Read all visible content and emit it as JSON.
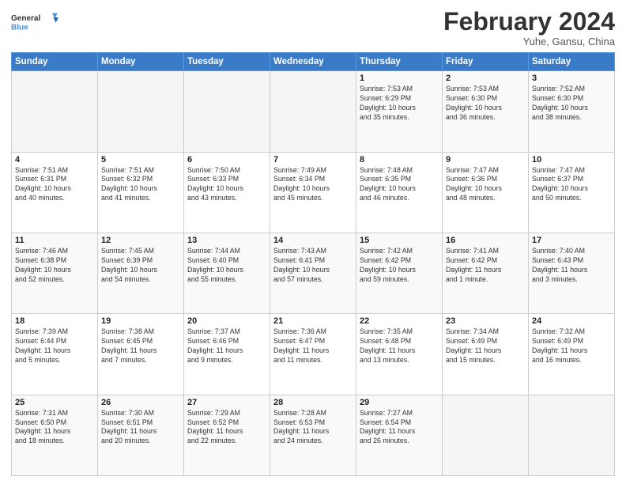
{
  "header": {
    "logo_general": "General",
    "logo_blue": "Blue",
    "month_title": "February 2024",
    "subtitle": "Yuhe, Gansu, China"
  },
  "days_of_week": [
    "Sunday",
    "Monday",
    "Tuesday",
    "Wednesday",
    "Thursday",
    "Friday",
    "Saturday"
  ],
  "weeks": [
    [
      {
        "day": "",
        "info": ""
      },
      {
        "day": "",
        "info": ""
      },
      {
        "day": "",
        "info": ""
      },
      {
        "day": "",
        "info": ""
      },
      {
        "day": "1",
        "info": "Sunrise: 7:53 AM\nSunset: 6:29 PM\nDaylight: 10 hours\nand 35 minutes."
      },
      {
        "day": "2",
        "info": "Sunrise: 7:53 AM\nSunset: 6:30 PM\nDaylight: 10 hours\nand 36 minutes."
      },
      {
        "day": "3",
        "info": "Sunrise: 7:52 AM\nSunset: 6:30 PM\nDaylight: 10 hours\nand 38 minutes."
      }
    ],
    [
      {
        "day": "4",
        "info": "Sunrise: 7:51 AM\nSunset: 6:31 PM\nDaylight: 10 hours\nand 40 minutes."
      },
      {
        "day": "5",
        "info": "Sunrise: 7:51 AM\nSunset: 6:32 PM\nDaylight: 10 hours\nand 41 minutes."
      },
      {
        "day": "6",
        "info": "Sunrise: 7:50 AM\nSunset: 6:33 PM\nDaylight: 10 hours\nand 43 minutes."
      },
      {
        "day": "7",
        "info": "Sunrise: 7:49 AM\nSunset: 6:34 PM\nDaylight: 10 hours\nand 45 minutes."
      },
      {
        "day": "8",
        "info": "Sunrise: 7:48 AM\nSunset: 6:35 PM\nDaylight: 10 hours\nand 46 minutes."
      },
      {
        "day": "9",
        "info": "Sunrise: 7:47 AM\nSunset: 6:36 PM\nDaylight: 10 hours\nand 48 minutes."
      },
      {
        "day": "10",
        "info": "Sunrise: 7:47 AM\nSunset: 6:37 PM\nDaylight: 10 hours\nand 50 minutes."
      }
    ],
    [
      {
        "day": "11",
        "info": "Sunrise: 7:46 AM\nSunset: 6:38 PM\nDaylight: 10 hours\nand 52 minutes."
      },
      {
        "day": "12",
        "info": "Sunrise: 7:45 AM\nSunset: 6:39 PM\nDaylight: 10 hours\nand 54 minutes."
      },
      {
        "day": "13",
        "info": "Sunrise: 7:44 AM\nSunset: 6:40 PM\nDaylight: 10 hours\nand 55 minutes."
      },
      {
        "day": "14",
        "info": "Sunrise: 7:43 AM\nSunset: 6:41 PM\nDaylight: 10 hours\nand 57 minutes."
      },
      {
        "day": "15",
        "info": "Sunrise: 7:42 AM\nSunset: 6:42 PM\nDaylight: 10 hours\nand 59 minutes."
      },
      {
        "day": "16",
        "info": "Sunrise: 7:41 AM\nSunset: 6:42 PM\nDaylight: 11 hours\nand 1 minute."
      },
      {
        "day": "17",
        "info": "Sunrise: 7:40 AM\nSunset: 6:43 PM\nDaylight: 11 hours\nand 3 minutes."
      }
    ],
    [
      {
        "day": "18",
        "info": "Sunrise: 7:39 AM\nSunset: 6:44 PM\nDaylight: 11 hours\nand 5 minutes."
      },
      {
        "day": "19",
        "info": "Sunrise: 7:38 AM\nSunset: 6:45 PM\nDaylight: 11 hours\nand 7 minutes."
      },
      {
        "day": "20",
        "info": "Sunrise: 7:37 AM\nSunset: 6:46 PM\nDaylight: 11 hours\nand 9 minutes."
      },
      {
        "day": "21",
        "info": "Sunrise: 7:36 AM\nSunset: 6:47 PM\nDaylight: 11 hours\nand 11 minutes."
      },
      {
        "day": "22",
        "info": "Sunrise: 7:35 AM\nSunset: 6:48 PM\nDaylight: 11 hours\nand 13 minutes."
      },
      {
        "day": "23",
        "info": "Sunrise: 7:34 AM\nSunset: 6:49 PM\nDaylight: 11 hours\nand 15 minutes."
      },
      {
        "day": "24",
        "info": "Sunrise: 7:32 AM\nSunset: 6:49 PM\nDaylight: 11 hours\nand 16 minutes."
      }
    ],
    [
      {
        "day": "25",
        "info": "Sunrise: 7:31 AM\nSunset: 6:50 PM\nDaylight: 11 hours\nand 18 minutes."
      },
      {
        "day": "26",
        "info": "Sunrise: 7:30 AM\nSunset: 6:51 PM\nDaylight: 11 hours\nand 20 minutes."
      },
      {
        "day": "27",
        "info": "Sunrise: 7:29 AM\nSunset: 6:52 PM\nDaylight: 11 hours\nand 22 minutes."
      },
      {
        "day": "28",
        "info": "Sunrise: 7:28 AM\nSunset: 6:53 PM\nDaylight: 11 hours\nand 24 minutes."
      },
      {
        "day": "29",
        "info": "Sunrise: 7:27 AM\nSunset: 6:54 PM\nDaylight: 11 hours\nand 26 minutes."
      },
      {
        "day": "",
        "info": ""
      },
      {
        "day": "",
        "info": ""
      }
    ]
  ]
}
